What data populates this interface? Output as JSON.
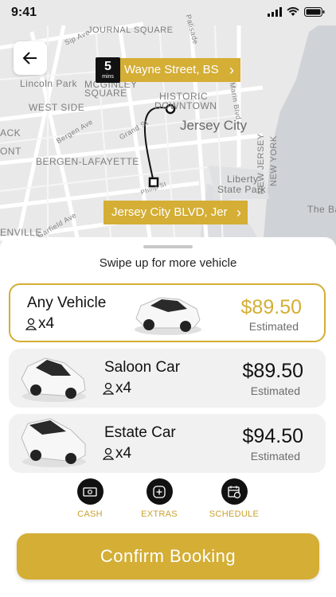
{
  "status_bar": {
    "time": "9:41",
    "icons": [
      "signal-icon",
      "wifi-icon",
      "battery-icon"
    ]
  },
  "map": {
    "eta": {
      "value": "5",
      "unit": "mins"
    },
    "destination_label": "Wayne Street, BS",
    "pickup_label": "Jersey City BLVD, Jer",
    "street_labels": {
      "journal_square": "JOURNAL SQUARE",
      "lincoln_park": "Lincoln Park",
      "mcginley": "MCGINLEY",
      "square": "SQUARE",
      "west_side": "WEST SIDE",
      "historic": "HISTORIC",
      "downtown": "DOWNTOWN",
      "jersey_city": "Jersey City",
      "bergen": "BERGEN-LAFAYETTE",
      "liberty1": "Liberty",
      "liberty2": "State Park",
      "new_jersey": "NEW JERSEY",
      "new_york": "NEW YORK",
      "the_ba": "The Ba",
      "ack": "ACK",
      "ont": "ONT",
      "enville": "ENVILLE",
      "sip_ave": "Sip Ave",
      "bergen_ave": "Bergen Ave",
      "grand_st": "Grand St",
      "garfield_ave": "Garfield Ave",
      "philip_st": "Philip St",
      "marin_blvd": "Marin Blvd",
      "palisade": "Palisade"
    }
  },
  "sheet": {
    "swipe_hint": "Swipe up for more vehicle",
    "vehicles": [
      {
        "name": "Any Vehicle",
        "seats": "x4",
        "price": "$89.50",
        "estimated": "Estimated",
        "selected": true
      },
      {
        "name": "Saloon Car",
        "seats": "x4",
        "price": "$89.50",
        "estimated": "Estimated",
        "selected": false
      },
      {
        "name": "Estate Car",
        "seats": "x4",
        "price": "$94.50",
        "estimated": "Estimated",
        "selected": false
      }
    ],
    "actions": [
      {
        "label": "CASH",
        "icon": "cash-icon"
      },
      {
        "label": "EXTRAS",
        "icon": "plus-icon"
      },
      {
        "label": "SCHEDULE",
        "icon": "calendar-icon"
      }
    ],
    "confirm_label": "Confirm Booking"
  },
  "colors": {
    "accent": "#d4ae35",
    "dark": "#111111",
    "card_bg": "#f1f1f1",
    "map_bg": "#e9e9ea"
  }
}
